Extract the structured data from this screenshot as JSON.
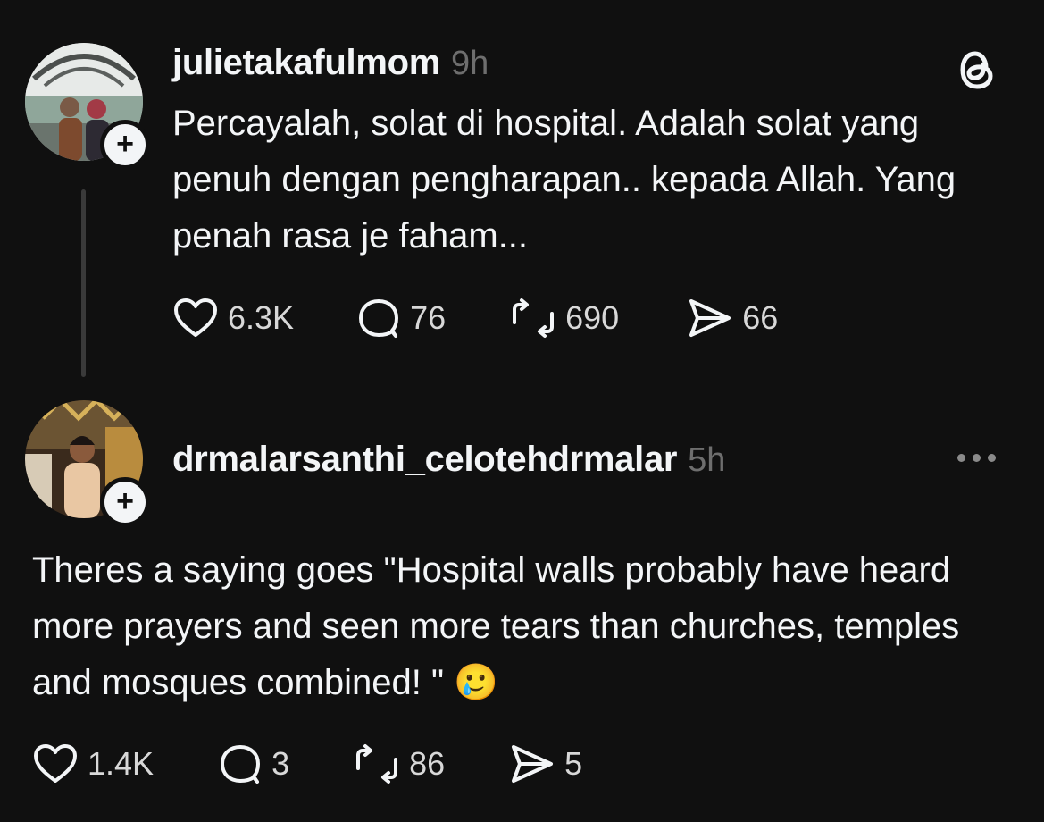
{
  "posts": [
    {
      "username": "julietakafulmom",
      "time": "9h",
      "text": "Percayalah, solat di hospital. Adalah solat yang penuh dengan pengharapan.. kepada Allah. Yang penah rasa je faham...",
      "likes": "6.3K",
      "replies": "76",
      "reposts": "690",
      "shares": "66"
    },
    {
      "username": "drmalarsanthi_celotehdrmalar",
      "time": "5h",
      "text": "Theres a saying goes \"Hospital walls probably have heard more prayers and seen more tears than churches, temples and mosques combined! \" 🥲",
      "likes": "1.4K",
      "replies": "3",
      "reposts": "86",
      "shares": "5"
    }
  ],
  "icons": {
    "logo": "threads-logo-icon",
    "like": "heart-icon",
    "reply": "comment-icon",
    "repost": "repost-icon",
    "share": "send-icon",
    "more": "more-options-icon",
    "follow": "plus-icon"
  },
  "colors": {
    "background": "#101010",
    "text": "#f3f5f7",
    "muted": "#6e6e6e"
  }
}
